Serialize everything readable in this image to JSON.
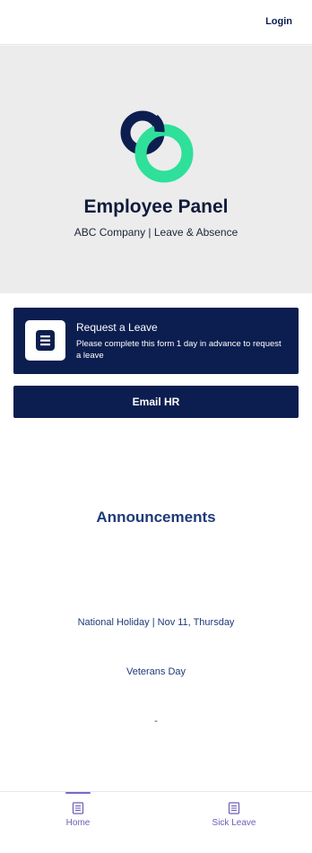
{
  "header": {
    "login_label": "Login"
  },
  "hero": {
    "title": "Employee Panel",
    "subtitle": "ABC Company | Leave & Absence",
    "logo_icon": "interlocking-rings-logo",
    "colors": {
      "navy": "#0c1e4f",
      "green": "#2ee09a"
    }
  },
  "request_card": {
    "icon": "document-icon",
    "title": "Request a Leave",
    "description": "Please complete this form 1 day in advance to request a leave"
  },
  "email_button": {
    "label": "Email HR"
  },
  "announcements": {
    "heading": "Announcements",
    "items": [
      "National Holiday | Nov 11, Thursday",
      "Veterans Day",
      "-"
    ]
  },
  "bottom_nav": {
    "items": [
      {
        "label": "Home",
        "icon": "form-icon",
        "active": true
      },
      {
        "label": "Sick Leave",
        "icon": "form-icon",
        "active": false
      }
    ],
    "accent": "#7b68c8"
  }
}
